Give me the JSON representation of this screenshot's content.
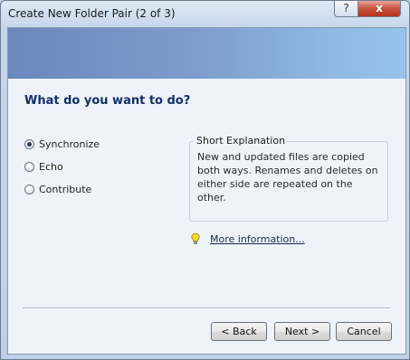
{
  "window": {
    "title": "Create New Folder Pair (2 of 3)",
    "help_label": "?",
    "close_label": "x"
  },
  "page": {
    "heading": "What do you want to do?"
  },
  "options": [
    {
      "label": "Synchronize",
      "selected": true
    },
    {
      "label": "Echo",
      "selected": false
    },
    {
      "label": "Contribute",
      "selected": false
    }
  ],
  "explanation": {
    "title": "Short Explanation",
    "text": "New and updated files are copied both ways. Renames and deletes on either side are repeated on the other."
  },
  "more_info": {
    "label": "More information...",
    "icon": "lightbulb-icon"
  },
  "buttons": {
    "back": "< Back",
    "next": "Next >",
    "cancel": "Cancel"
  },
  "colors": {
    "heading": "#12306c",
    "banner_start": "#6b88bd",
    "banner_end": "#97c4ea"
  }
}
